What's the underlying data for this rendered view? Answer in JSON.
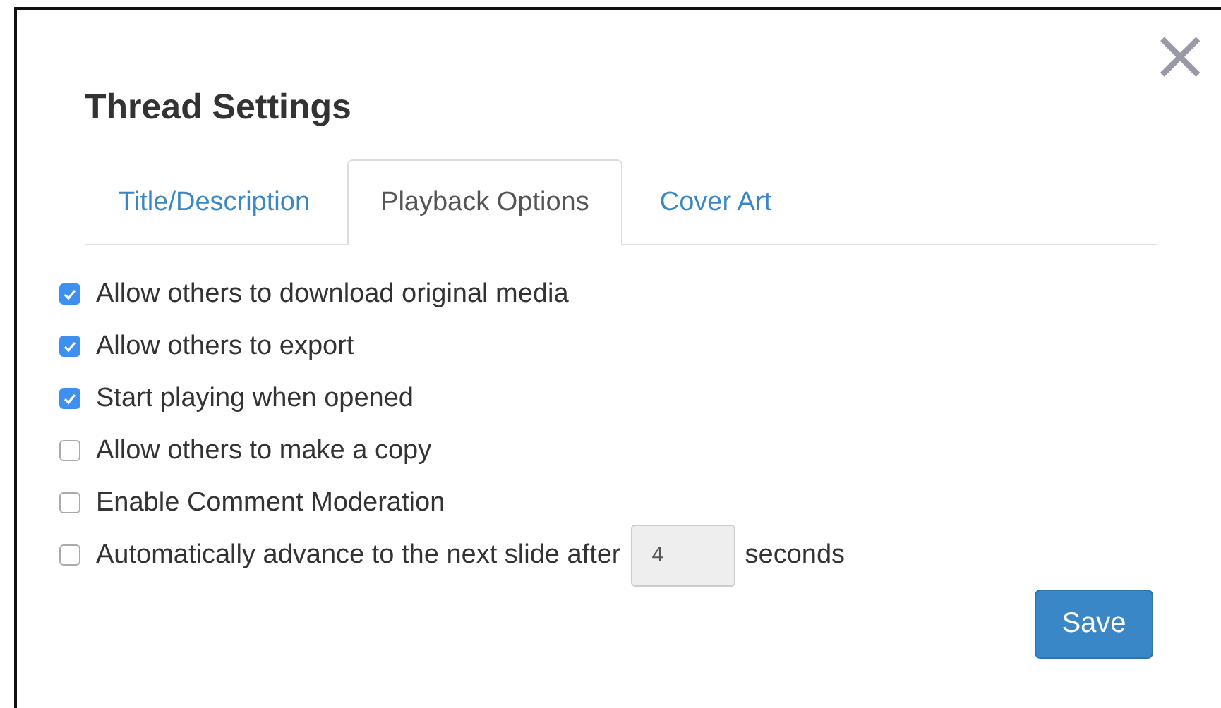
{
  "dialog": {
    "title": "Thread Settings",
    "close": "×"
  },
  "tabs": [
    {
      "label": "Title/Description",
      "selected": false
    },
    {
      "label": "Playback Options",
      "selected": true
    },
    {
      "label": "Cover Art",
      "selected": false
    }
  ],
  "options": [
    {
      "kind": "checkbox",
      "label": "Allow others to download original media",
      "checked": true
    },
    {
      "kind": "checkbox",
      "label": "Allow others to export",
      "checked": true
    },
    {
      "kind": "checkbox",
      "label": "Start playing when opened",
      "checked": true
    },
    {
      "kind": "checkbox",
      "label": "Allow others to make a copy",
      "checked": false
    },
    {
      "kind": "checkbox",
      "label": "Enable Comment Moderation",
      "checked": false
    },
    {
      "kind": "number",
      "label": "Automatically advance to the next slide after",
      "value": "4",
      "suffix": "seconds",
      "checked": false
    }
  ],
  "buttons": {
    "save": "Save"
  }
}
